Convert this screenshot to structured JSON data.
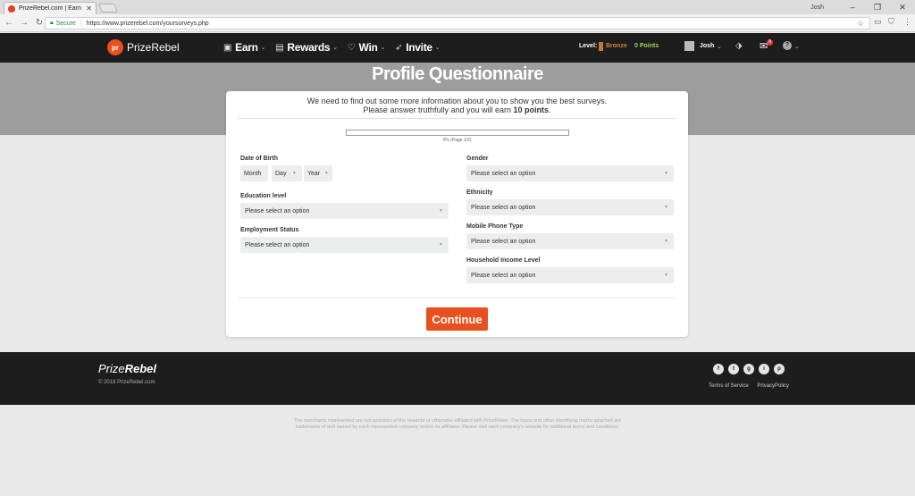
{
  "browser": {
    "tab_title": "PrizeRebel.com | Earn Pa",
    "tab_close": "✕",
    "window_user": "Josh",
    "secure_label": "Secure",
    "url": "https://www.prizerebel.com/yoursurveys.php"
  },
  "header": {
    "logo_badge": "pr",
    "logo_text": "PrizeRebel",
    "nav": [
      {
        "label": "Earn",
        "icon": "wallet-icon"
      },
      {
        "label": "Rewards",
        "icon": "gift-icon"
      },
      {
        "label": "Win",
        "icon": "heart-icon"
      },
      {
        "label": "Invite",
        "icon": "paper-plane-icon"
      }
    ],
    "level_label": "Level:",
    "level_value": "Bronze",
    "points": "0 Points",
    "username": "Josh",
    "mail_count": "9"
  },
  "page": {
    "title": "Profile Questionnaire",
    "intro_line1": "We need to find out some more information about you to show you the best surveys.",
    "intro_line2_prefix": "Please answer truthfully and you will earn",
    "intro_points": "10 points",
    "intro_suffix": ".",
    "progress_percent": 0,
    "progress_label": "0% (Page 1/2)"
  },
  "form": {
    "dob_label": "Date of Birth",
    "dob_month": "Month",
    "dob_day": "Day",
    "dob_year": "Year",
    "education_label": "Education level",
    "education_value": "Please select an option",
    "employment_label": "Employment Status",
    "employment_value": "Please select an option",
    "gender_label": "Gender",
    "gender_value": "Please select an option",
    "ethnicity_label": "Ethnicity",
    "ethnicity_value": "Please select an option",
    "phone_label": "Mobile Phone Type",
    "phone_value": "Please select an option",
    "income_label": "Household Income Level",
    "income_value": "Please select an option",
    "continue_label": "Continue"
  },
  "footer": {
    "logo_prefix": "Prize",
    "logo_bold": "Rebel",
    "copyright": "© 2018 PrizeRebel.com",
    "social": [
      "f",
      "t",
      "g",
      "i",
      "p"
    ],
    "terms": "Terms of Service",
    "privacy": "PrivacyPolicy",
    "disclaimer": "The merchants represented are not sponsors of the rewards or otherwise affiliated with PrizeRebel. The logos and other identifying marks attached are trademarks of and owned by each represented company and/or its affiliates. Please visit each company's website for additional terms and conditions."
  },
  "colors": {
    "brand_orange": "#e8501f",
    "header_bg": "#1d1d1d",
    "banner_bg": "#9d9d9d",
    "bronze": "#d0843a",
    "points_green": "#9bd25c"
  }
}
